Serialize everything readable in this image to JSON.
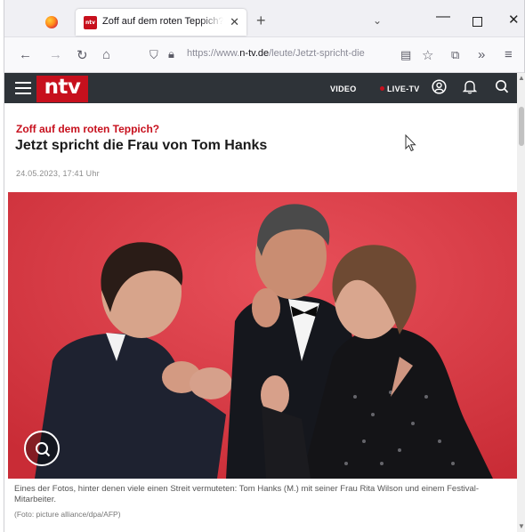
{
  "browser": {
    "tab_title": "Zoff auf dem roten Teppich?: Je",
    "tab_favicon": "ntv",
    "url_prefix": "https://www.",
    "url_domain": "n-tv.de",
    "url_path": "/leute/Jetzt-spricht-die"
  },
  "site": {
    "logo": "ntv",
    "nav_video": "VIDEO",
    "nav_live": "LIVE-TV"
  },
  "article": {
    "kicker": "Zoff auf dem roten Teppich?",
    "headline": "Jetzt spricht die Frau von Tom Hanks",
    "date": "24.05.2023, 17:41 Uhr",
    "caption": "Eines der Fotos, hinter denen viele einen Streit vermuteten: Tom Hanks (M.) mit seiner Frau Rita Wilson und einem Festival-Mitarbeiter.",
    "credit": "(Foto: picture alliance/dpa/AFP)"
  },
  "icons": [
    "firefox-icon",
    "close-icon",
    "plus-icon",
    "chevron-down-icon",
    "minimize-icon",
    "maximize-icon",
    "back-icon",
    "forward-icon",
    "reload-icon",
    "home-icon",
    "shield-icon",
    "lock-icon",
    "reader-icon",
    "star-icon",
    "extensions-icon",
    "overflow-icon",
    "menu-icon",
    "hamburger-icon",
    "account-icon",
    "bell-icon",
    "search-icon",
    "zoom-icon"
  ],
  "colors": {
    "brand_red": "#c7101d",
    "header_dark": "#2e3338",
    "photo_backdrop": "#d93b45"
  }
}
